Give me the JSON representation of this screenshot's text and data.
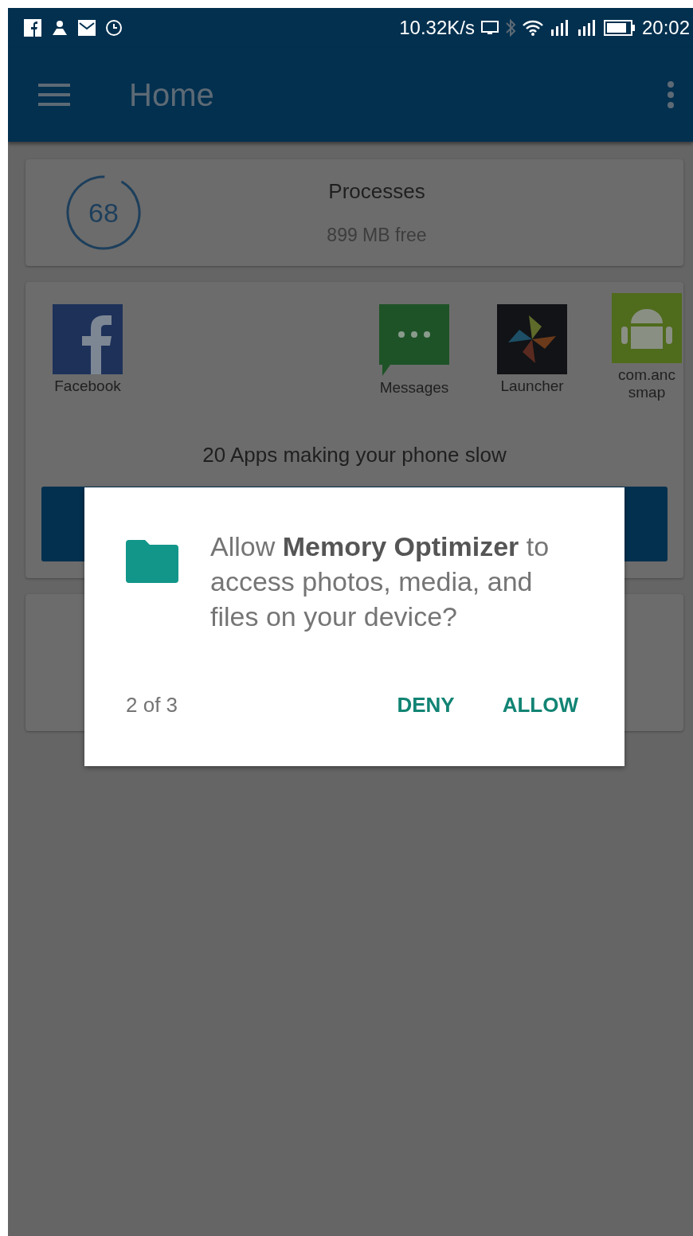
{
  "status_bar": {
    "speed": "10.32K/s",
    "time": "20:02"
  },
  "app_bar": {
    "title": "Home"
  },
  "processes_card": {
    "count": "68",
    "title": "Processes",
    "subtitle": "899 MB free"
  },
  "apps": [
    {
      "kind": "facebook",
      "lines": [
        "Facebook"
      ]
    },
    {
      "kind": "messages",
      "lines": [
        "Messages"
      ]
    },
    {
      "kind": "launcher",
      "lines": [
        "Launcher"
      ]
    },
    {
      "kind": "android",
      "lines": [
        "com.anc",
        "smap"
      ]
    }
  ],
  "apps_message": "20 Apps making your phone slow",
  "dialog": {
    "message": "Allow **Memory Optimizer** to access photos, media, and files on your device?",
    "counter": "2 of 3",
    "buttons": [
      "DENY",
      "ALLOW"
    ]
  }
}
